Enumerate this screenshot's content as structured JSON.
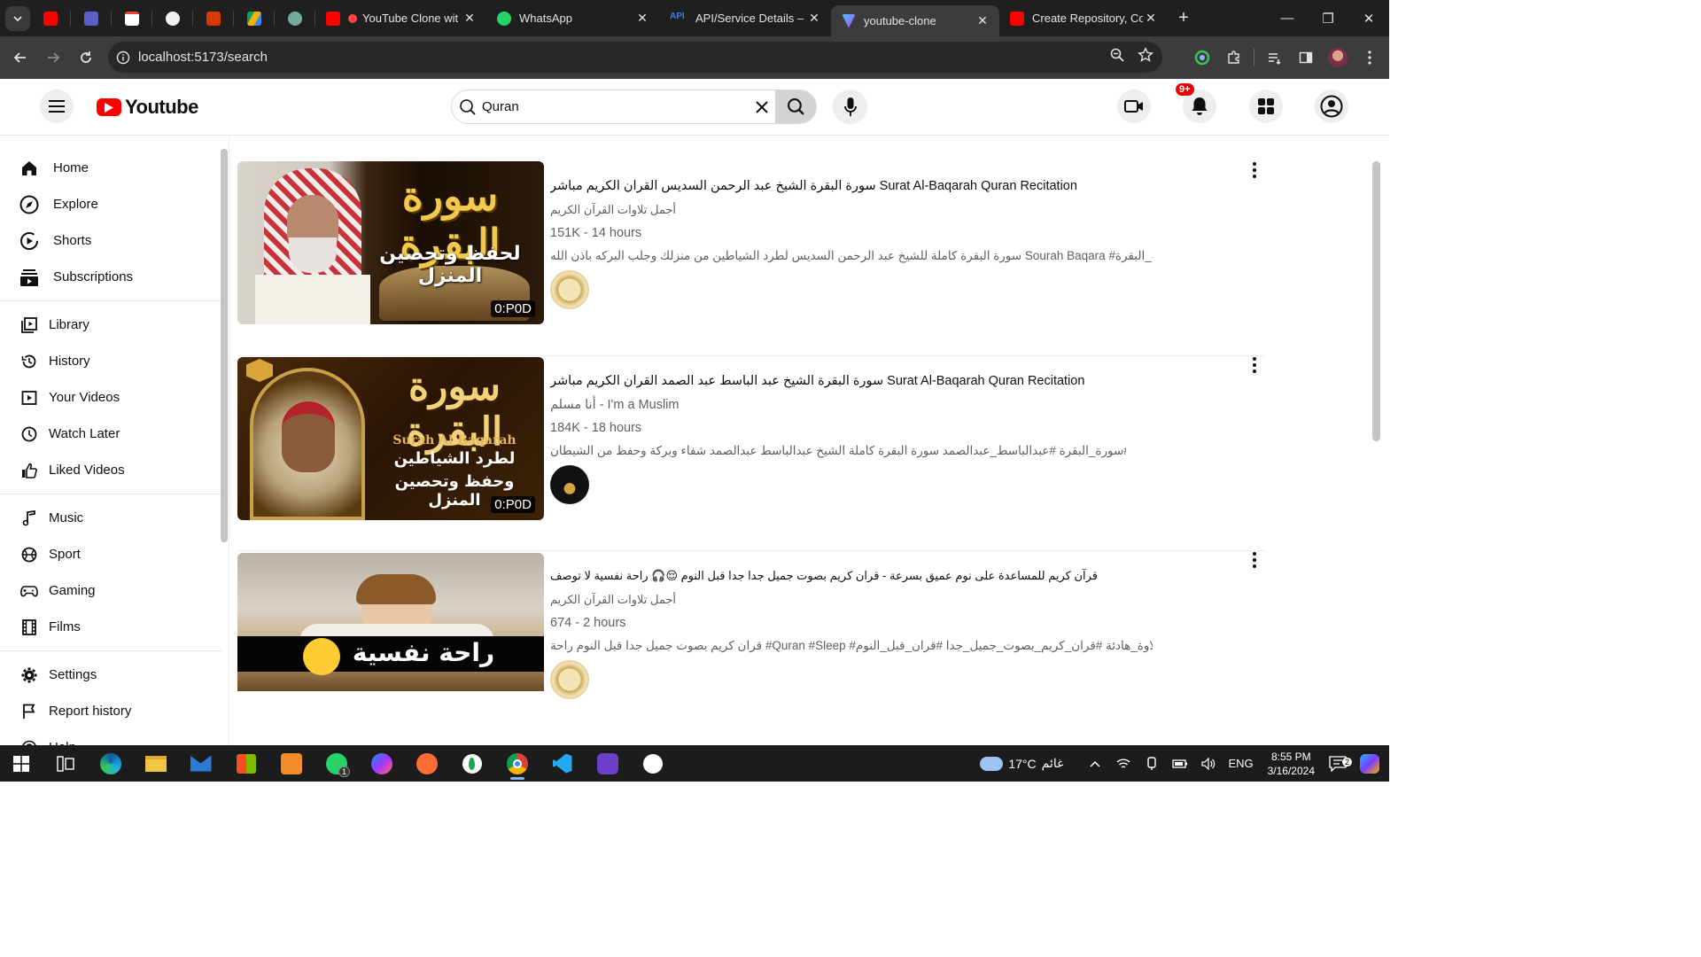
{
  "browser": {
    "tabs": [
      {
        "title": "YouTube Clone wit",
        "favicon_color": "#ff0000"
      },
      {
        "title": "WhatsApp",
        "favicon_color": "#25d366"
      },
      {
        "title": "API/Service Details – A",
        "favicon_color": "#4a7bd8"
      },
      {
        "title": "youtube-clone",
        "favicon_color": "#a855f7",
        "active": true
      },
      {
        "title": "Create Repository, Con",
        "favicon_color": "#ff0000"
      }
    ],
    "pinned_tabs": [
      "youtube-icon",
      "teams-icon",
      "gmail-icon",
      "github-icon",
      "office-icon",
      "drive-icon",
      "chatgpt-icon"
    ],
    "url": "localhost:5173/search"
  },
  "header": {
    "logo_text": "Youtube",
    "search_value": "Quran",
    "notification_badge": "9+"
  },
  "sidebar": {
    "groups": [
      [
        {
          "label": "Home",
          "icon": "home-icon"
        },
        {
          "label": "Explore",
          "icon": "explore-icon"
        },
        {
          "label": "Shorts",
          "icon": "shorts-icon"
        },
        {
          "label": "Subscriptions",
          "icon": "subscriptions-icon"
        }
      ],
      [
        {
          "label": "Library",
          "icon": "library-icon"
        },
        {
          "label": "History",
          "icon": "history-icon"
        },
        {
          "label": "Your Videos",
          "icon": "your-videos-icon"
        },
        {
          "label": "Watch Later",
          "icon": "watch-later-icon"
        },
        {
          "label": "Liked Videos",
          "icon": "liked-videos-icon"
        }
      ],
      [
        {
          "label": "Music",
          "icon": "music-icon"
        },
        {
          "label": "Sport",
          "icon": "sport-icon"
        },
        {
          "label": "Gaming",
          "icon": "gaming-icon"
        },
        {
          "label": "Films",
          "icon": "films-icon"
        }
      ],
      [
        {
          "label": "Settings",
          "icon": "settings-icon"
        },
        {
          "label": "Report history",
          "icon": "report-icon"
        },
        {
          "label": "Help",
          "icon": "help-icon"
        }
      ]
    ]
  },
  "videos": [
    {
      "title": "سورة البقرة الشيخ عبد الرحمن السديس القران الكريم مباشر Surat Al-Baqarah Quran Recitation",
      "channel": "أجمل تلاوات القرآن الكريم",
      "stats": "151K - 14 hours",
      "description": "سورة البقرة كاملة للشيخ عبد الرحمن السديس لطرد الشياطين من منزلك وجلب البركه باذن الله Sourah Baqara #سورة_البقرة ...",
      "duration": "0:P0D",
      "thumb_text_1": "سورة البقرة",
      "thumb_text_2": "لحفظ وتحصين المنزل"
    },
    {
      "title": "سورة البقرة الشيخ عبد الباسط عبد الصمد القران الكريم مباشر Surat Al-Baqarah Quran Recitation",
      "channel": "أنا مسلم - I'm a Muslim",
      "stats": "184K - 18 hours",
      "description": "أنا_مسلم #قرآن_كريم #سورة_البقرة #عبدالباسط_عبدالصمد سورة البقرة كاملة الشيخ عبدالباسط عبدالصمد شفاء وبركة وحفظ من الشيطان ...",
      "duration": "0:P0D",
      "thumb_text_1": "سورة البقرة",
      "thumb_text_2": "Surah Al Baqarah",
      "thumb_text_3": "لطرد الشياطين",
      "thumb_text_4": "وحفظ وتحصين المنزل"
    },
    {
      "title": "قرآن كريم للمساعدة على نوم عميق بسرعة - قران كريم بصوت جميل جدا جدا قبل النوم 😌🎧 راحة نفسية لا توصف",
      "channel": "أجمل تلاوات القرآن الكريم",
      "stats": "674 - 2 hours",
      "description": "قران كريم بصوت جميل جدا قبل النوم راحة #Quran #Sleep #قرآن_كريم #تلاوة_هادئة #قران_كريم_بصوت_جميل_جدا #قران_قبل_النوم ...",
      "thumb_text_1": "راحة نفسية"
    }
  ],
  "taskbar": {
    "weather_temp": "17°C",
    "weather_text": "غائم",
    "lang": "ENG",
    "time": "8:55 PM",
    "date": "3/16/2024",
    "whatsapp_badge": "1",
    "notif_count": "2"
  }
}
